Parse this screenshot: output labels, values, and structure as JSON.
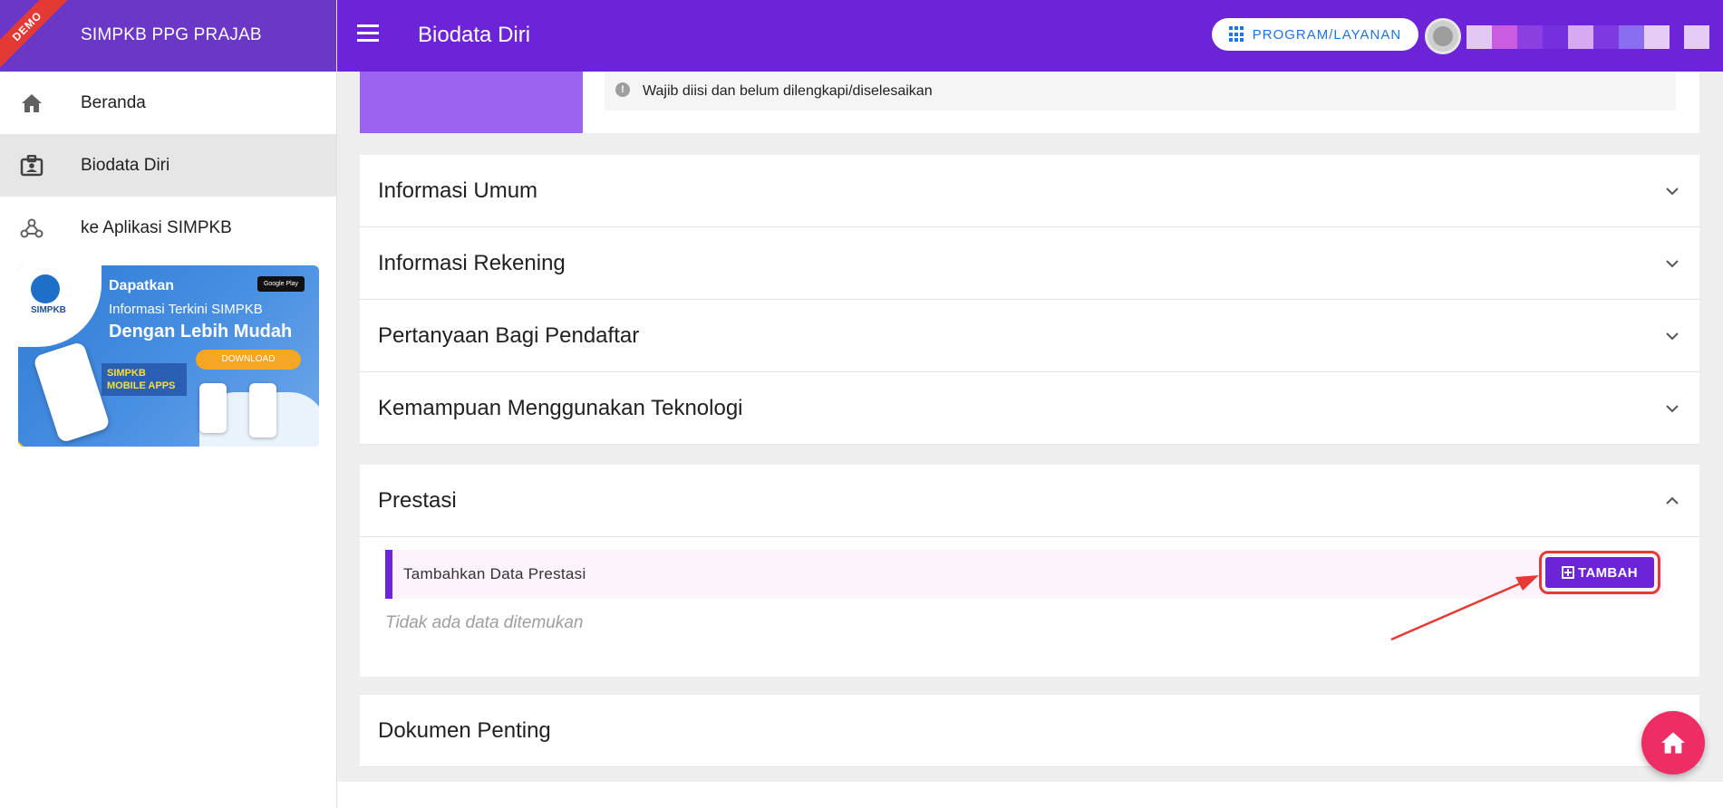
{
  "app": {
    "brand": "SIMPKB PPG PRAJAB",
    "ribbon": "DEMO",
    "page_title": "Biodata Diri"
  },
  "header": {
    "program_button": "PROGRAM/LAYANAN"
  },
  "sidebar": {
    "items": [
      {
        "label": "Beranda",
        "icon": "home-icon",
        "active": false
      },
      {
        "label": "Biodata Diri",
        "icon": "id-badge-icon",
        "active": true
      },
      {
        "label": "ke Aplikasi SIMPKB",
        "icon": "webhook-icon",
        "active": false
      }
    ],
    "banner": {
      "line1": "Dapatkan",
      "line2": "Informasi Terkini SIMPKB",
      "line3": "Dengan Lebih Mudah",
      "download": "DOWNLOAD",
      "mobile_apps": "SIMPKB MOBILE APPS",
      "logo": "SIMPKB",
      "store": "Google Play"
    }
  },
  "notice": {
    "text": "Wajib diisi dan belum dilengkapi/diselesaikan"
  },
  "sections": [
    {
      "title": "Informasi Umum",
      "expanded": false
    },
    {
      "title": "Informasi Rekening",
      "expanded": false
    },
    {
      "title": "Pertanyaan Bagi Pendaftar",
      "expanded": false
    },
    {
      "title": "Kemampuan Menggunakan Teknologi",
      "expanded": false
    }
  ],
  "prestasi": {
    "title": "Prestasi",
    "expanded": true,
    "add_text": "Tambahkan Data Prestasi",
    "add_button": "TAMBAH",
    "empty": "Tidak ada data ditemukan"
  },
  "dokumen": {
    "title": "Dokumen Penting",
    "expanded": false
  },
  "colors": {
    "header": "#6d24d9",
    "brand": "#6a37c7",
    "accent_blue": "#1e74e8",
    "highlight_red": "#e53935",
    "fab": "#ef2d65"
  }
}
